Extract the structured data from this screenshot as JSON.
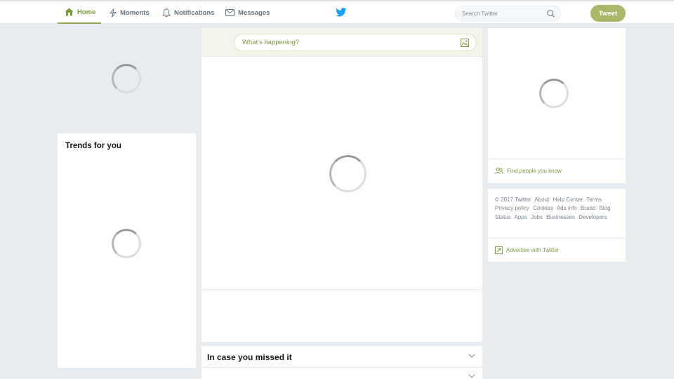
{
  "nav": {
    "home": "Home",
    "moments": "Moments",
    "notifications": "Notifications",
    "messages": "Messages"
  },
  "search": {
    "placeholder": "Search Twitter"
  },
  "tweet_button": "Tweet",
  "trends": {
    "title": "Trends for you"
  },
  "compose": {
    "placeholder": "What's happening?"
  },
  "missed": {
    "title": "In case you missed it"
  },
  "who_to_follow": {
    "find_link": "Find people you know"
  },
  "footer": {
    "links": [
      "© 2017 Twitter",
      "About",
      "Help Center",
      "Terms",
      "Privacy policy",
      "Cookies",
      "Ads info",
      "Brand",
      "Blog",
      "Status",
      "Apps",
      "Jobs",
      "Businesses",
      "Developers"
    ],
    "advertise": "Advertise with Twitter"
  },
  "colors": {
    "accent": "#7d9a45",
    "tweet_button": "#a9b76b",
    "background": "#e6ecf0",
    "bird": "#1da1f2"
  },
  "icons": [
    "home-icon",
    "moments-icon",
    "notifications-icon",
    "messages-icon",
    "twitter-bird-icon",
    "search-icon",
    "image-icon",
    "people-icon",
    "advertise-icon",
    "chevron-down-icon",
    "loading-spinner"
  ]
}
